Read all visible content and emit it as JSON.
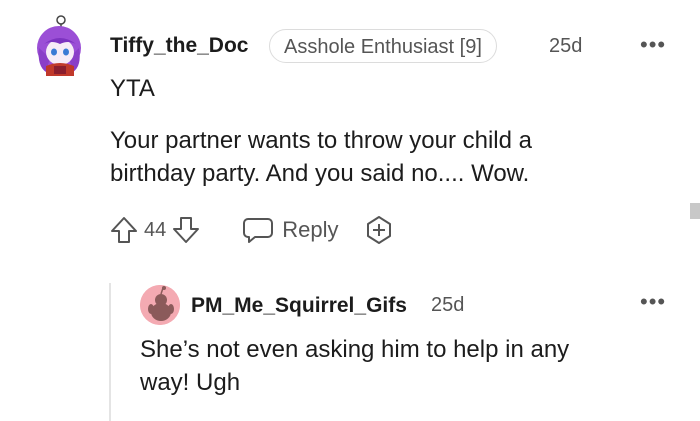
{
  "comment": {
    "username": "Tiffy_the_Doc",
    "flair": "Asshole Enthusiast [9]",
    "time": "25d",
    "verdict": "YTA",
    "body_line1": "Your partner wants to throw your child a",
    "body_line2": "birthday party. And you said no.... Wow.",
    "vote_count": "44",
    "reply_label": "Reply",
    "icons": [
      "upvote-icon",
      "downvote-icon",
      "reply-icon",
      "award-icon",
      "more-options-icon"
    ]
  },
  "reply": {
    "username": "PM_Me_Squirrel_Gifs",
    "time": "25d",
    "body_line1": "She’s not even asking him to help in any",
    "body_line2": "way! Ugh"
  },
  "colors": {
    "text": "#1c1c1c",
    "meta": "#555555",
    "avatar_purple": "#a855d8",
    "avatar_pink": "#f2a5ad"
  }
}
